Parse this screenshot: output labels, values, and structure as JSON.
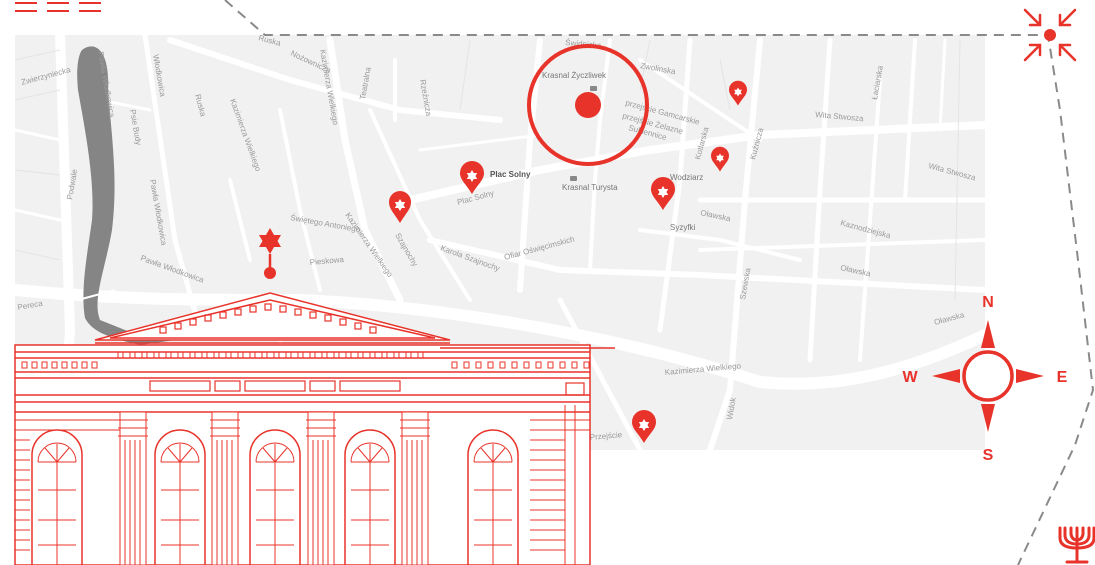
{
  "colors": {
    "accent": "#e8332a",
    "map_background": "#f1f1f1",
    "river": "#858585",
    "street": "#ffffff",
    "label": "#9a9a9a",
    "dashed_path": "#8a8a8a"
  },
  "map": {
    "streets": [
      {
        "id": "ruska",
        "label": "Ruska"
      },
      {
        "id": "kazimierza-1",
        "label": "Kazimierza Wielkiego"
      },
      {
        "id": "kazimierza-2",
        "label": "Kazimierza Wielkiego"
      },
      {
        "id": "kazimierza-3",
        "label": "Kazimierza Wielkiego"
      },
      {
        "id": "psie-budy",
        "label": "Psie Budy"
      },
      {
        "id": "nozownicza",
        "label": "Nożownicza"
      },
      {
        "id": "wlodkowica-1",
        "label": "Pawła Włodkowica"
      },
      {
        "id": "wlodkowica-2",
        "label": "Pawła Włodkowica"
      },
      {
        "id": "antoniego",
        "label": "Świętego Antoniego"
      },
      {
        "id": "pieskowa",
        "label": "Pieskowa"
      },
      {
        "id": "karola",
        "label": "Karola Szajnochy"
      },
      {
        "id": "ofiar",
        "label": "Ofiar Oświęcimskich"
      },
      {
        "id": "olawska-1",
        "label": "Oławska"
      },
      {
        "id": "olawska-2",
        "label": "Oławska"
      },
      {
        "id": "olawska-3",
        "label": "Oławska"
      },
      {
        "id": "wita-1",
        "label": "Wita Stwosza"
      },
      {
        "id": "wita-2",
        "label": "Wita Stwosza"
      },
      {
        "id": "kazmodzejska",
        "label": "Kaznodziejska"
      },
      {
        "id": "laciarska",
        "label": "Łaciarska"
      },
      {
        "id": "widok",
        "label": "Widok"
      },
      {
        "id": "zwolinska",
        "label": "Zwolinska"
      },
      {
        "id": "sukiennice",
        "label": "Sukiennice"
      },
      {
        "id": "gamcarska",
        "label": "przejście Gamcarskie"
      },
      {
        "id": "zelazne",
        "label": "przejście Żelazne"
      },
      {
        "id": "kuznicza",
        "label": "Kuźnicza"
      },
      {
        "id": "szewska",
        "label": "Szewska"
      },
      {
        "id": "kotlarska",
        "label": "Kotlarska"
      },
      {
        "id": "przejscie",
        "label": "Przejście"
      },
      {
        "id": "sw-antoniego",
        "label": "Świdnicka"
      },
      {
        "id": "teatralna",
        "label": "Teatralna"
      },
      {
        "id": "ruska-upper",
        "label": "Ruska"
      },
      {
        "id": "pawla-upper",
        "label": "Pawła Włodkowica"
      },
      {
        "id": "kazimierza-left",
        "label": "Kazimierza Wielkiego"
      },
      {
        "id": "wlodkowica-right",
        "label": "Włodkowica"
      },
      {
        "id": "placpiesza",
        "label": "Plac Solny"
      },
      {
        "id": "szajnochy",
        "label": "Szajnochy"
      },
      {
        "id": "tasse",
        "label": "Zwierzyniecka"
      },
      {
        "id": "podwale",
        "label": "Podwale"
      },
      {
        "id": "pereca",
        "label": "Pereca"
      },
      {
        "id": "rzeznicza",
        "label": "Rzeźnicza"
      }
    ],
    "places": [
      {
        "id": "krasnal-zyczliwek",
        "label": "Krasnal Życzliwek"
      },
      {
        "id": "plac-solny",
        "label": "Plac Solny"
      },
      {
        "id": "krasnal-turysta",
        "label": "Krasnal Turysta"
      },
      {
        "id": "krasnal-wodziarz",
        "label": "Wodziarz"
      },
      {
        "id": "syzyfki",
        "label": "Syzyfki"
      }
    ],
    "markers": [
      {
        "id": "synagogue-white-stork",
        "type": "star-of-david-marker"
      },
      {
        "id": "marker-plac-solny",
        "type": "star-of-david-marker"
      },
      {
        "id": "marker-krasnal-turysta",
        "type": "star-of-david-marker"
      },
      {
        "id": "marker-olawska",
        "type": "star-of-david-marker"
      },
      {
        "id": "marker-laciarska",
        "type": "star-of-david-marker"
      },
      {
        "id": "marker-wita-stwosza",
        "type": "star-of-david-marker"
      },
      {
        "id": "marker-sw-antoniego",
        "type": "star-of-david-marker"
      }
    ],
    "current_location": {
      "label": "current-location"
    }
  },
  "compass": {
    "north": "N",
    "south": "S",
    "east": "E",
    "west": "W"
  },
  "icons": {
    "menu": "hamburger-icon",
    "collapse": "collapse-arrows-icon",
    "menorah": "menorah-icon",
    "building": "synagogue-facade-illustration",
    "star": "star-of-david-icon"
  }
}
